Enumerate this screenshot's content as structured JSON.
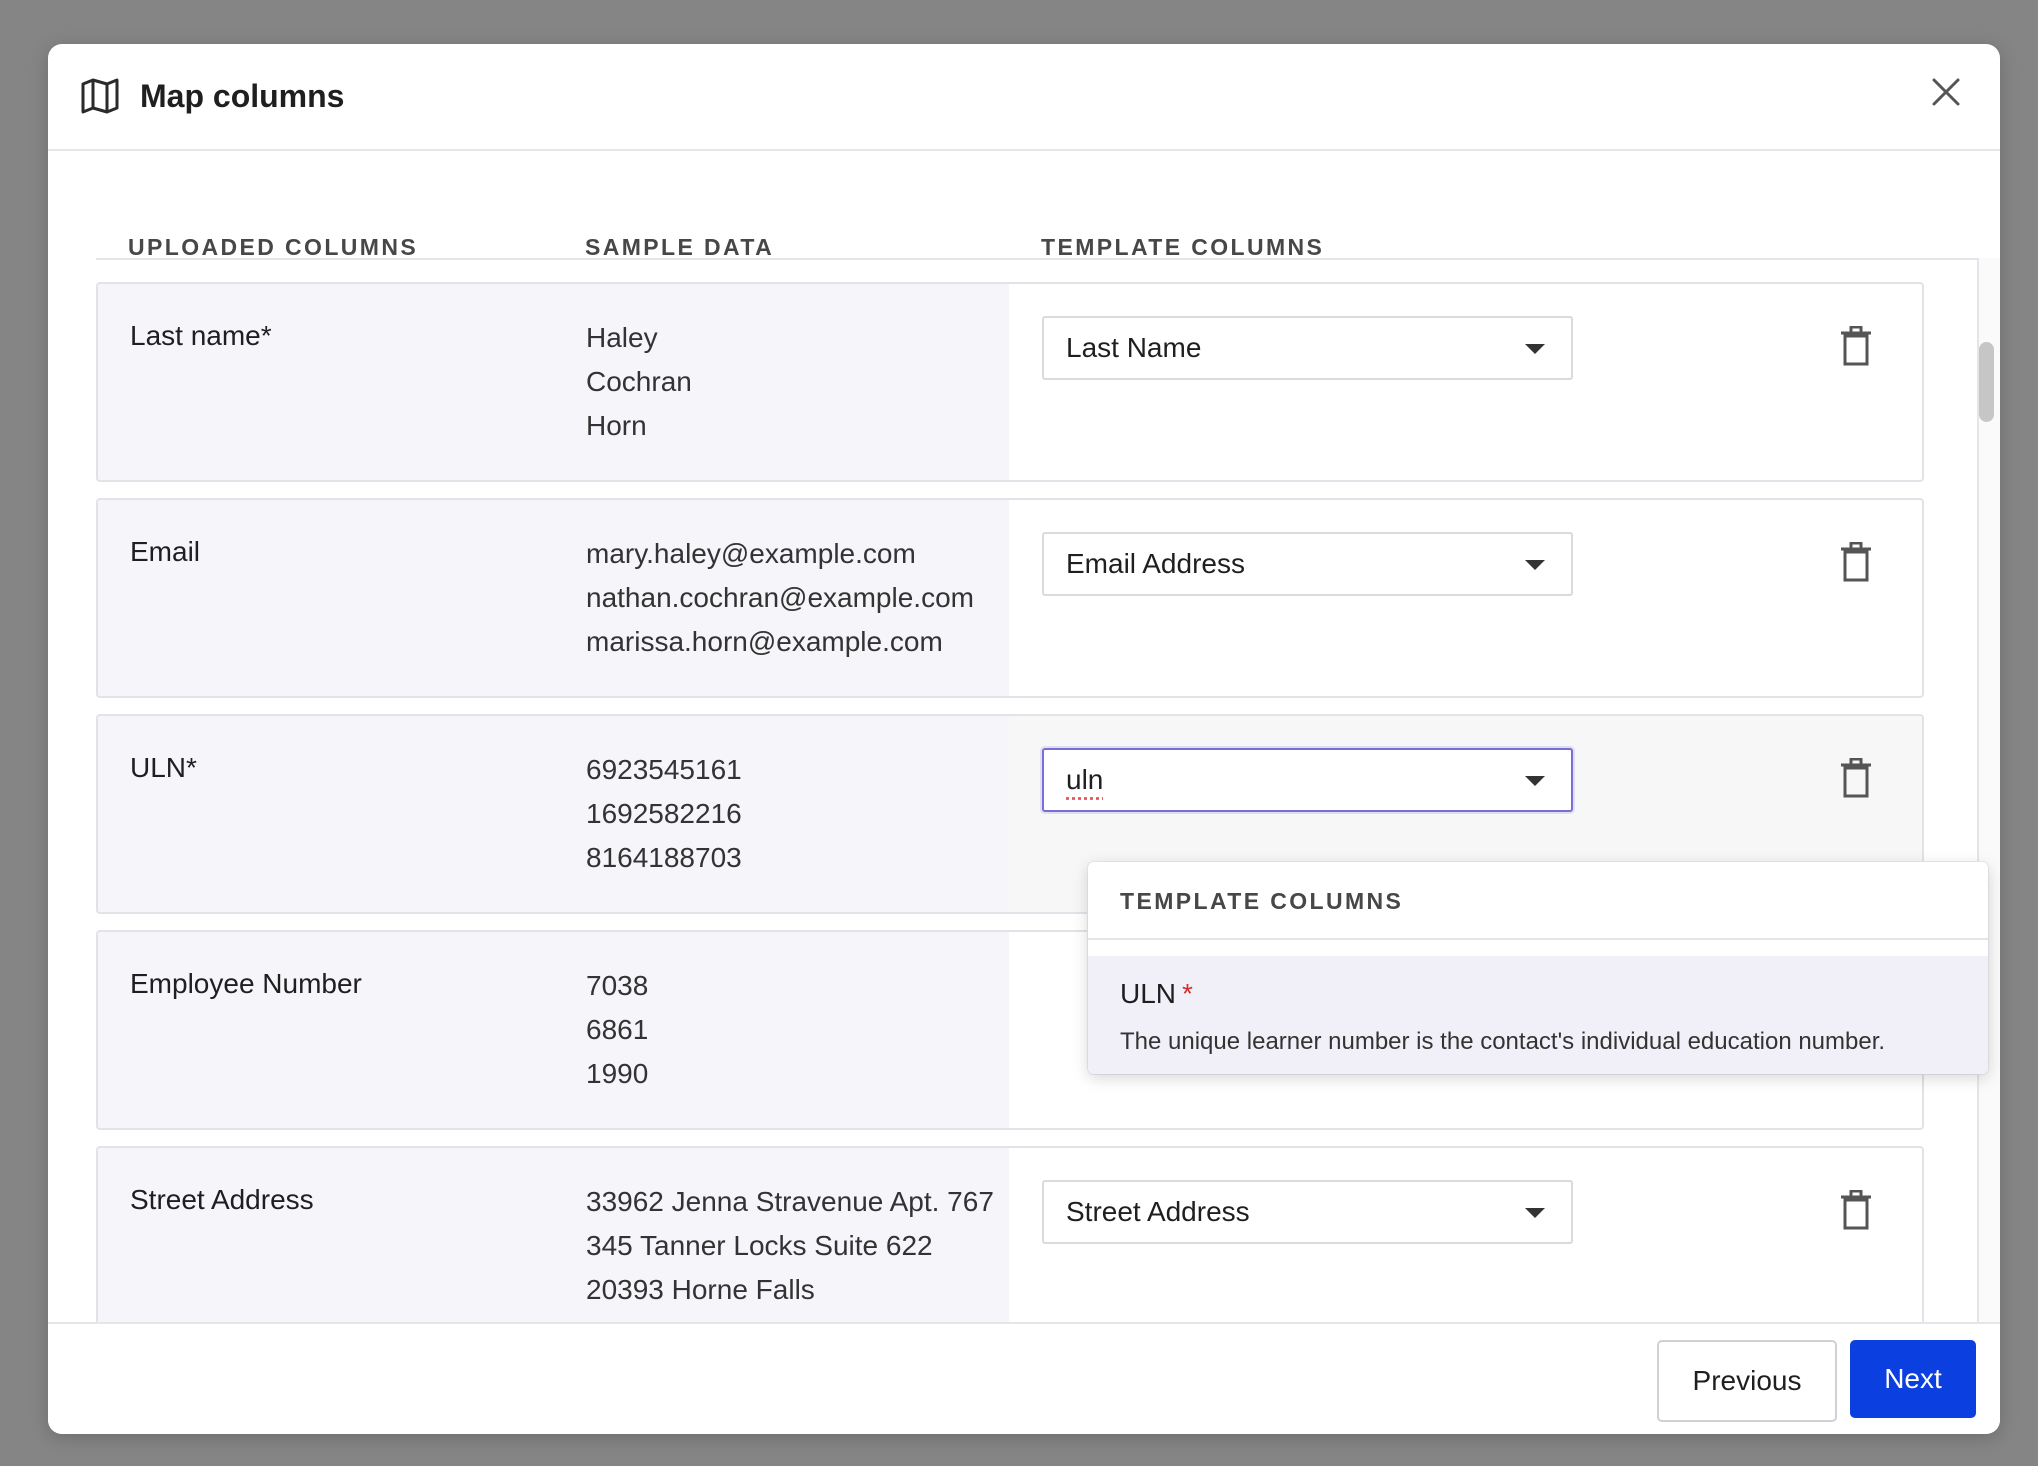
{
  "modal": {
    "title": "Map columns",
    "icon": "map-icon"
  },
  "columns": {
    "uploaded": "UPLOADED COLUMNS",
    "sample": "SAMPLE DATA",
    "template": "TEMPLATE COLUMNS"
  },
  "rows": [
    {
      "uploaded": "Last name*",
      "samples": [
        "Haley",
        "Cochran",
        "Horn"
      ],
      "template": "Last Name"
    },
    {
      "uploaded": "Email",
      "samples": [
        "mary.haley@example.com",
        "nathan.cochran@example.com",
        "marissa.horn@example.com"
      ],
      "template": "Email Address"
    },
    {
      "uploaded": "ULN*",
      "samples": [
        "6923545161",
        "1692582216",
        "8164188703"
      ],
      "template": "uln"
    },
    {
      "uploaded": "Employee Number",
      "samples": [
        "7038",
        "6861",
        "1990"
      ],
      "template": ""
    },
    {
      "uploaded": "Street Address",
      "samples": [
        "33962 Jenna Stravenue Apt. 767",
        "345 Tanner Locks Suite 622",
        "20393 Horne Falls"
      ],
      "template": "Street Address"
    }
  ],
  "dropdown": {
    "header": "TEMPLATE COLUMNS",
    "option": {
      "label": "ULN",
      "required_mark": "*",
      "description": "The unique learner number is the contact's individual education number."
    }
  },
  "footer": {
    "previous": "Previous",
    "next": "Next"
  },
  "colors": {
    "primary": "#0b3fe0",
    "required": "#d32f2f",
    "focus": "#7a6fd8"
  }
}
